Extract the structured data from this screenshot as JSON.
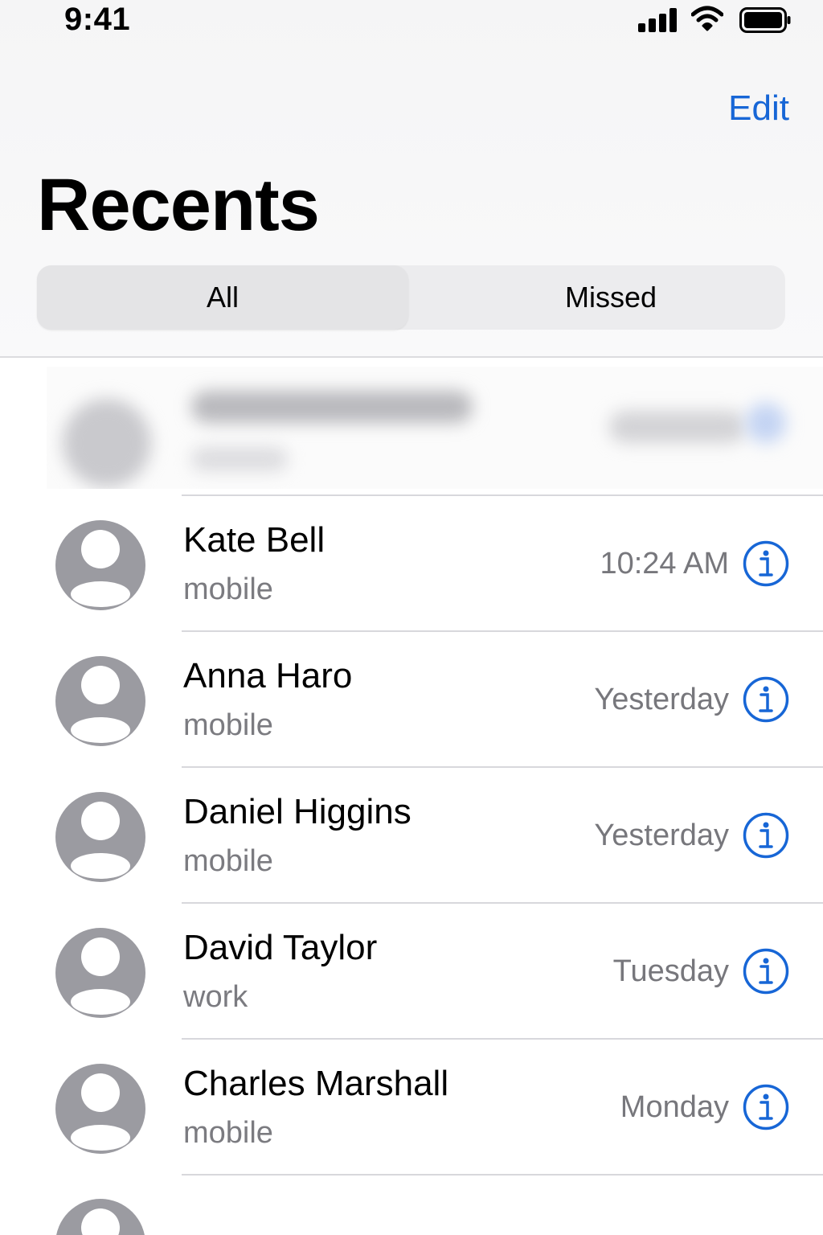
{
  "status_bar": {
    "time": "9:41",
    "icons": [
      "cellular-signal-icon",
      "wifi-icon",
      "battery-icon"
    ]
  },
  "nav": {
    "edit_label": "Edit"
  },
  "title": "Recents",
  "segments": {
    "all_label": "All",
    "missed_label": "Missed",
    "selected": "All"
  },
  "calls": [
    {
      "name": "Kate Bell",
      "type": "mobile",
      "time": "10:24 AM"
    },
    {
      "name": "Anna Haro",
      "type": "mobile",
      "time": "Yesterday"
    },
    {
      "name": "Daniel Higgins",
      "type": "mobile",
      "time": "Yesterday"
    },
    {
      "name": "David Taylor",
      "type": "work",
      "time": "Tuesday"
    },
    {
      "name": "Charles Marshall",
      "type": "mobile",
      "time": "Monday"
    }
  ],
  "colors": {
    "accent": "#1766d6",
    "secondary_text": "#7b7b80",
    "avatar_gray": "#9b9ba1"
  }
}
